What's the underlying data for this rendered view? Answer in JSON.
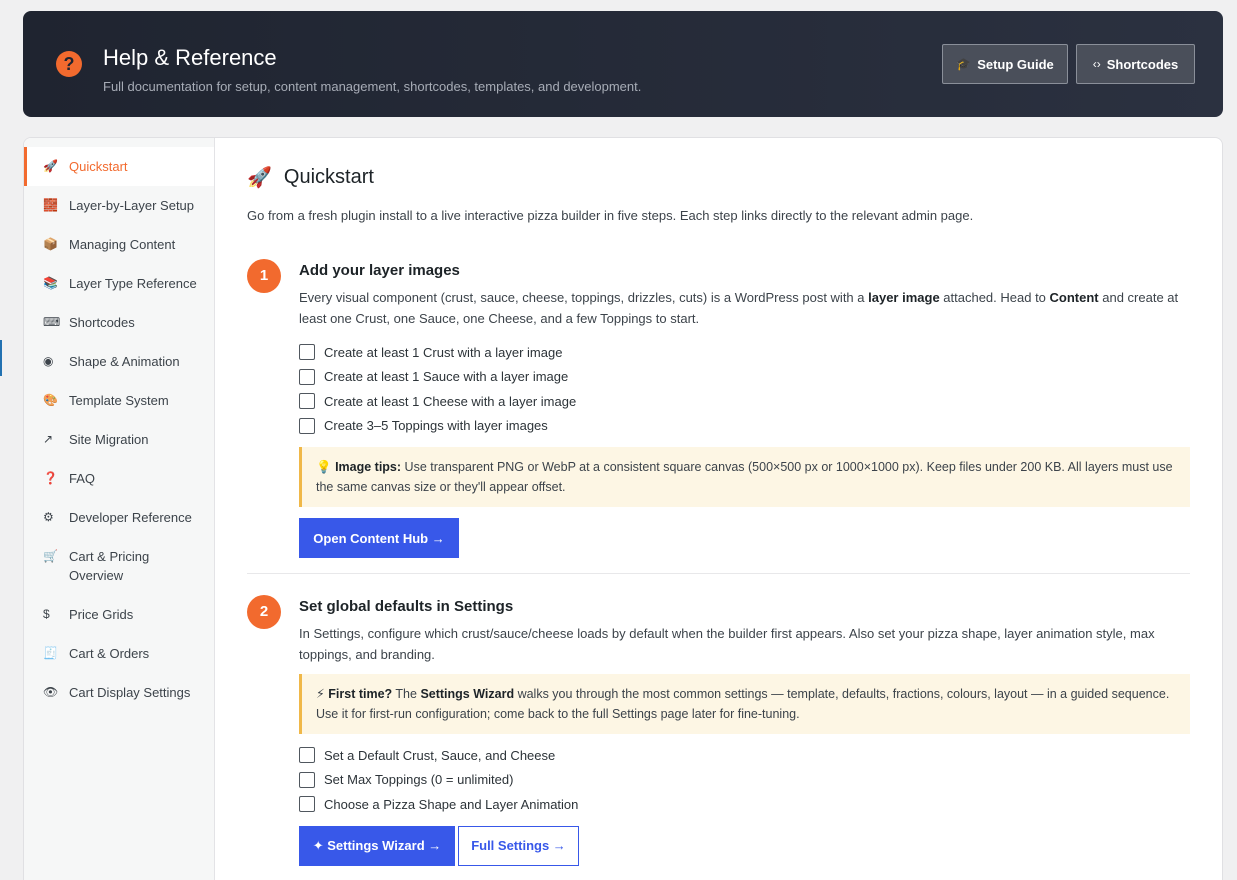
{
  "header": {
    "title": "Help & Reference",
    "subtitle": "Full documentation for setup, content management, shortcodes, templates, and development.",
    "setup_guide": "Setup Guide",
    "shortcodes": "Shortcodes"
  },
  "sidebar": {
    "items": [
      {
        "icon": "🚀",
        "label": "Quickstart"
      },
      {
        "icon": "🧱",
        "label": "Layer-by-Layer Setup"
      },
      {
        "icon": "📦",
        "label": "Managing Content"
      },
      {
        "icon": "📚",
        "label": "Layer Type Reference"
      },
      {
        "icon": "⌨",
        "label": "Shortcodes"
      },
      {
        "icon": "◉",
        "label": "Shape & Animation"
      },
      {
        "icon": "🎨",
        "label": "Template System"
      },
      {
        "icon": "↗",
        "label": "Site Migration"
      },
      {
        "icon": "❓",
        "label": "FAQ"
      },
      {
        "icon": "⚙",
        "label": "Developer Reference"
      },
      {
        "icon": "🛒",
        "label": "Cart & Pricing Overview"
      },
      {
        "icon": "$",
        "label": "Price Grids"
      },
      {
        "icon": "🧾",
        "label": "Cart & Orders"
      },
      {
        "icon": "👁",
        "label": "Cart Display Settings"
      }
    ]
  },
  "main": {
    "title_icon": "🚀",
    "title": "Quickstart",
    "intro": "Go from a fresh plugin install to a live interactive pizza builder in five steps. Each step links directly to the relevant admin page.",
    "step1": {
      "number": "1",
      "title": "Add your layer images",
      "desc_a": "Every visual component (crust, sauce, cheese, toppings, drizzles, cuts) is a WordPress post with a ",
      "desc_b": "layer image",
      "desc_c": " attached. Head to ",
      "desc_d": "Content",
      "desc_e": " and create at least one Crust, one Sauce, one Cheese, and a few Toppings to start.",
      "checks": [
        "Create at least 1 Crust with a layer image",
        "Create at least 1 Sauce with a layer image",
        "Create at least 1 Cheese with a layer image",
        "Create 3–5 Toppings with layer images"
      ],
      "tip_icon": "💡",
      "tip_bold": "Image tips:",
      "tip_text": " Use transparent PNG or WebP at a consistent square canvas (500×500 px or 1000×1000 px). Keep files under 200 KB. All layers must use the same canvas size or they'll appear offset.",
      "button": "Open Content Hub →"
    },
    "step2": {
      "number": "2",
      "title": "Set global defaults in Settings",
      "desc": "In Settings, configure which crust/sauce/cheese loads by default when the builder first appears. Also set your pizza shape, layer animation style, max toppings, and branding.",
      "tip_icon": "⚡",
      "tip_bold_a": "First time?",
      "tip_text_a": " The ",
      "tip_bold_b": "Settings Wizard",
      "tip_text_b": " walks you through the most common settings — template, defaults, fractions, colours, layout — in a guided sequence. Use it for first-run configuration; come back to the full Settings page later for fine-tuning.",
      "checks": [
        "Set a Default Crust, Sauce, and Cheese",
        "Set Max Toppings (0 = unlimited)",
        "Choose a Pizza Shape and Layer Animation"
      ],
      "button_primary": "✦ Settings Wizard →",
      "button_secondary": "Full Settings →"
    }
  }
}
